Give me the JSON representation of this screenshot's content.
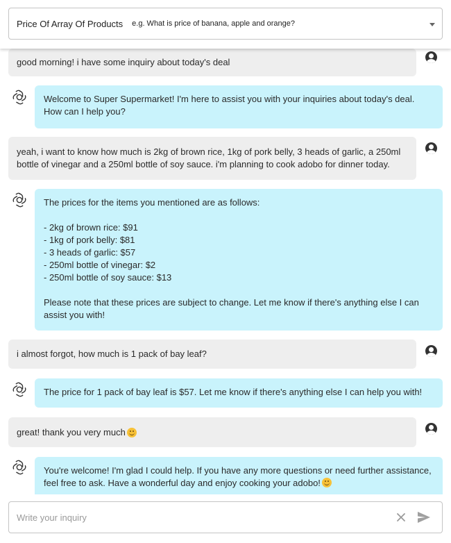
{
  "header": {
    "topic_label": "Price Of Array Of Products",
    "topic_hint": "e.g. What is price of banana, apple and orange?"
  },
  "messages": [
    {
      "role": "user",
      "text": "good morning! i have some inquiry about today's deal"
    },
    {
      "role": "assistant",
      "text": "Welcome to Super Supermarket! I'm here to assist you with your inquiries about today's deal.\nHow can I help you?"
    },
    {
      "role": "user",
      "text": "yeah, i want to know how much is 2kg of brown rice, 1kg of pork belly, 3 heads of garlic, a 250ml\nbottle of vinegar and a 250ml bottle of soy sauce. i'm planning to cook adobo for dinner today."
    },
    {
      "role": "assistant",
      "text": "The prices for the items you mentioned are as follows:\n\n- 2kg of brown rice: $91\n- 1kg of pork belly: $81\n- 3 heads of garlic: $57\n- 250ml bottle of vinegar: $2\n- 250ml bottle of soy sauce: $13\n\nPlease note that these prices are subject to change. Let me know if there's anything else I can\nassist you with!"
    },
    {
      "role": "user",
      "text": "i almost forgot, how much is 1 pack of bay leaf?"
    },
    {
      "role": "assistant",
      "text": "The price for 1 pack of bay leaf is $57. Let me know if there's anything else I can help you with!"
    },
    {
      "role": "user",
      "text": "great! thank you very much",
      "emoji": "smiling-face"
    },
    {
      "role": "assistant",
      "text": "You're welcome! I'm glad I could help. If you have any more questions or need further assistance,\nfeel free to ask. Have a wonderful day and enjoy cooking your adobo!",
      "emoji": "smiling-face"
    }
  ],
  "input": {
    "placeholder": "Write your inquiry",
    "value": ""
  },
  "icons": {
    "user_avatar": "user-circle-icon",
    "bot_avatar": "openai-logo-icon",
    "clear": "close-icon",
    "send": "send-icon",
    "dropdown": "chevron-down-icon"
  },
  "colors": {
    "user_bubble": "#eeeeee",
    "assistant_bubble": "#c9f3fc"
  }
}
